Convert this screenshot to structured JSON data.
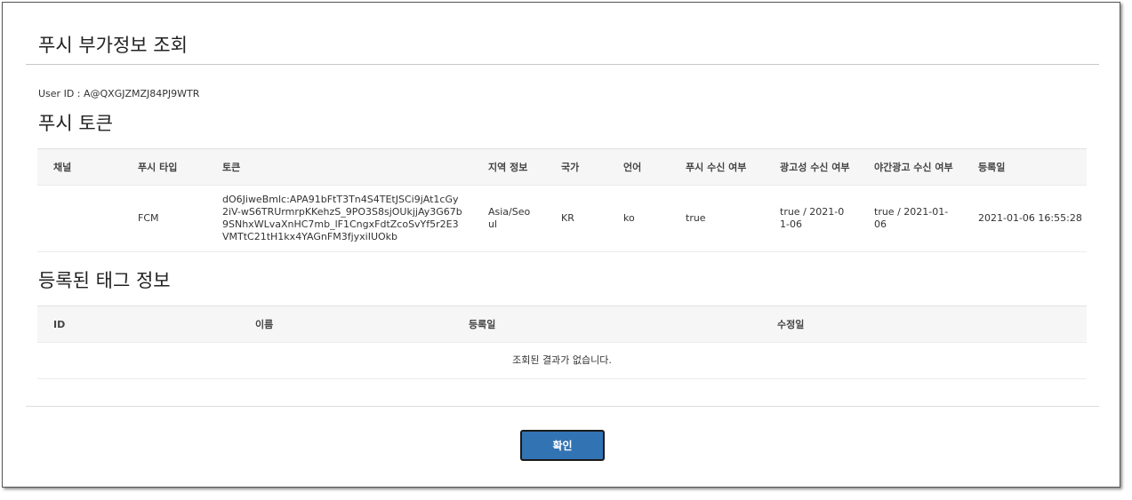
{
  "modal": {
    "title": "푸시 부가정보 조회",
    "user_id": "User ID : A@QXGJZMZJ84PJ9WTR",
    "confirm_label": "확인"
  },
  "token_section": {
    "title": "푸시 토큰",
    "headers": [
      "채널",
      "푸시 타입",
      "토큰",
      "지역 정보",
      "국가",
      "언어",
      "푸시 수신 여부",
      "광고성 수신 여부",
      "야간광고 수신 여부",
      "등록일"
    ],
    "rows": [
      {
        "channel": "",
        "push_type": "FCM",
        "token": "dO6JiweBmlc:APA91bFtT3Tn4S4TEtJSCi9jAt1cGy2iV-wS6TRUrmrpKKehzS_9PO3S8sjOUkjjAy3G67b9SNhxWLvaXnHC7mb_lF1CngxFdtZcoSvYf5r2E3VMTtC21tH1kx4YAGnFM3fjyxiIUOkb",
        "region": "Asia/Seoul",
        "country": "KR",
        "language": "ko",
        "push_enabled": "true",
        "ad_enabled": "true / 2021-01-06",
        "night_ad_enabled": "true / 2021-01-06",
        "registered_at": "2021-01-06 16:55:28"
      }
    ]
  },
  "tag_section": {
    "title": "등록된 태그 정보",
    "headers": [
      "ID",
      "이름",
      "등록일",
      "수정일"
    ],
    "empty_message": "조회된 결과가 없습니다."
  }
}
